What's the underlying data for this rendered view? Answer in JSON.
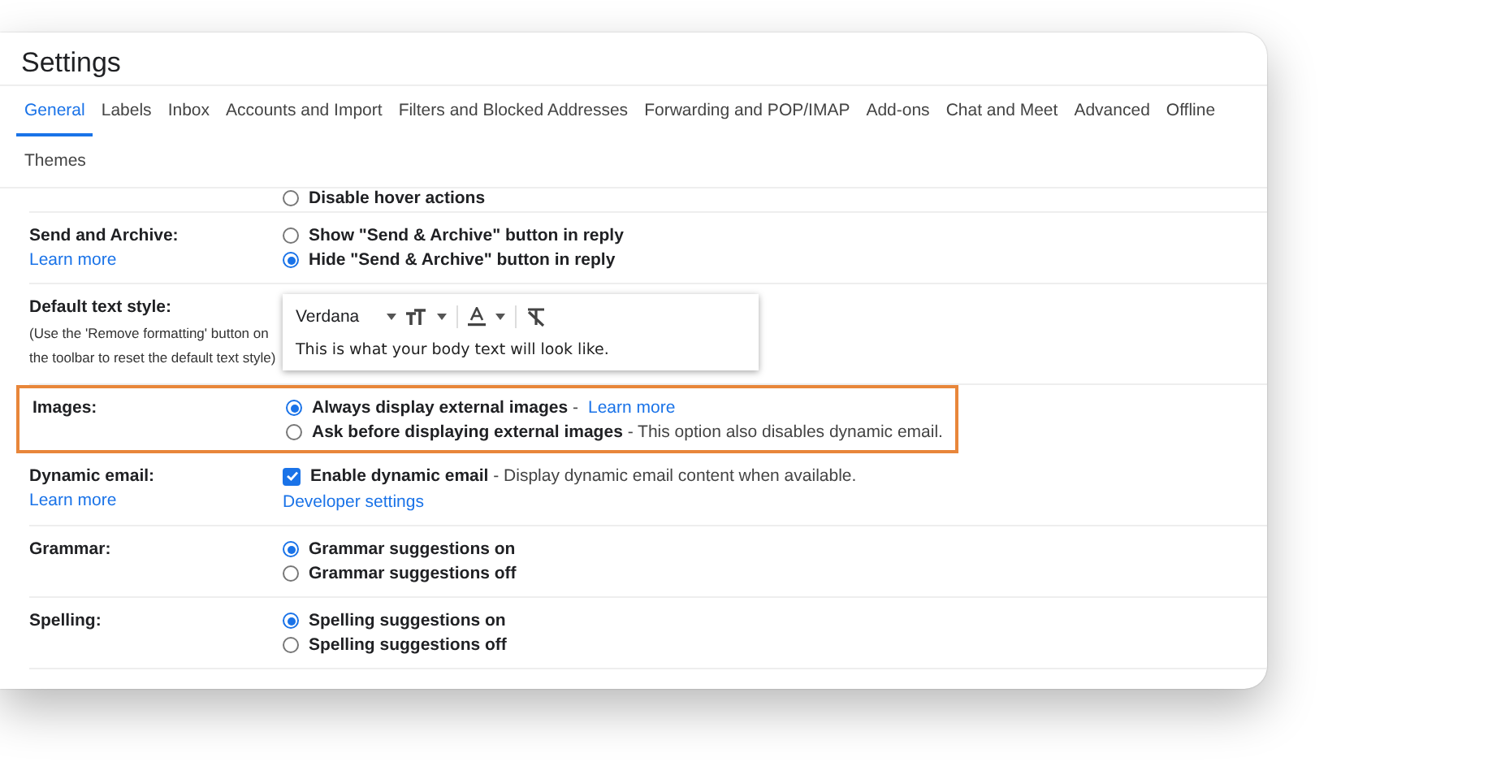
{
  "window": {
    "title": "Settings"
  },
  "tabs": [
    {
      "label": "General",
      "selected": true
    },
    {
      "label": "Labels",
      "selected": false
    },
    {
      "label": "Inbox",
      "selected": false
    },
    {
      "label": "Accounts and Import",
      "selected": false
    },
    {
      "label": "Filters and Blocked Addresses",
      "selected": false
    },
    {
      "label": "Forwarding and POP/IMAP",
      "selected": false
    },
    {
      "label": "Add-ons",
      "selected": false
    },
    {
      "label": "Chat and Meet",
      "selected": false
    },
    {
      "label": "Advanced",
      "selected": false
    },
    {
      "label": "Offline",
      "selected": false
    },
    {
      "label": "Themes",
      "selected": false
    }
  ],
  "sections": [
    {
      "kind": "partial",
      "options": [
        {
          "text": "Disable hover actions",
          "selected": false
        }
      ]
    },
    {
      "kind": "radio",
      "label": "Send and Archive:",
      "link": "Learn more",
      "highlighted": false,
      "options": [
        {
          "text": "Show \"Send & Archive\" button in reply",
          "selected": false
        },
        {
          "text": "Hide \"Send & Archive\" button in reply",
          "selected": true
        }
      ]
    },
    {
      "kind": "editor",
      "label": "Default text style:",
      "hint": "(Use the 'Remove formatting' button on the toolbar to reset the default text style)",
      "highlighted": false,
      "editor": {
        "font": "Verdana",
        "preview": "This is what your body text will look like."
      }
    },
    {
      "kind": "radio",
      "label": "Images:",
      "highlighted": true,
      "options": [
        {
          "text": "Always display external images",
          "note": "-",
          "link": "Learn more",
          "selected": true
        },
        {
          "text": "Ask before displaying external images",
          "note": "- This option also disables dynamic email.",
          "selected": false
        }
      ]
    },
    {
      "kind": "checkbox",
      "label": "Dynamic email:",
      "link": "Learn more",
      "highlighted": false,
      "sub_link": "Developer settings",
      "options": [
        {
          "text": "Enable dynamic email",
          "note": "- Display dynamic email content when available.",
          "checked": true
        }
      ]
    },
    {
      "kind": "radio",
      "label": "Grammar:",
      "highlighted": false,
      "options": [
        {
          "text": "Grammar suggestions on",
          "selected": true
        },
        {
          "text": "Grammar suggestions off",
          "selected": false
        }
      ]
    },
    {
      "kind": "radio",
      "label": "Spelling:",
      "highlighted": false,
      "options": [
        {
          "text": "Spelling suggestions on",
          "selected": true
        },
        {
          "text": "Spelling suggestions off",
          "selected": false
        }
      ]
    }
  ]
}
